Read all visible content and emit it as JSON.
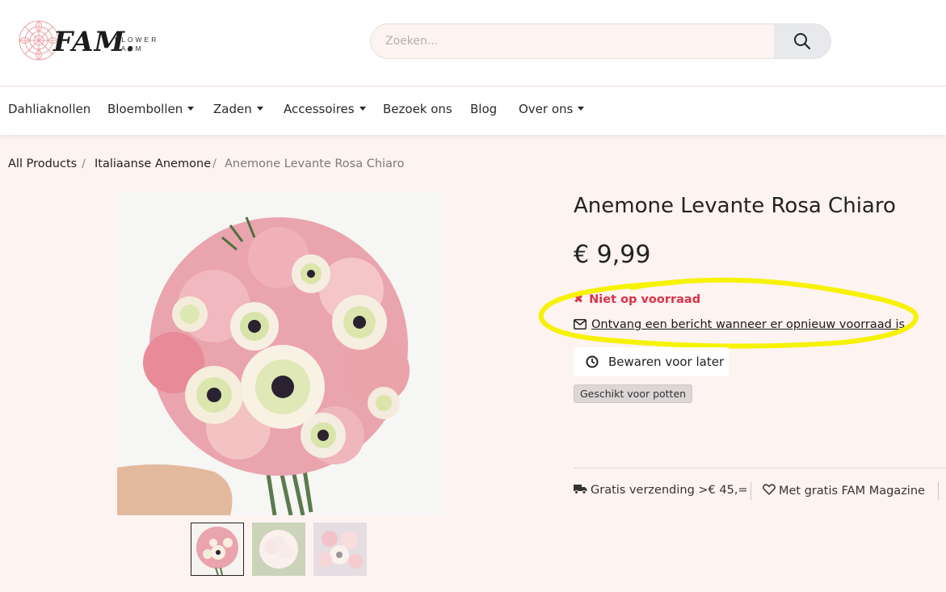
{
  "brand": {
    "logo_main": "FAM.",
    "logo_sub": "FLOWER FARM",
    "primary_color": "#d9334a",
    "highlight_color": "#f7f200",
    "background_color": "#fdf3f1"
  },
  "search": {
    "placeholder": "Zoeken...",
    "icon": "search-icon"
  },
  "nav": {
    "items": [
      {
        "label": "Dahliaknollen",
        "dropdown": false
      },
      {
        "label": "Bloembollen",
        "dropdown": true
      },
      {
        "label": "Zaden",
        "dropdown": true
      },
      {
        "label": "Accessoires",
        "dropdown": true
      },
      {
        "label": "Bezoek ons",
        "dropdown": false
      },
      {
        "label": "Blog",
        "dropdown": false
      },
      {
        "label": "Over ons",
        "dropdown": true
      }
    ]
  },
  "breadcrumb": {
    "items": [
      "All Products",
      "Italiaanse Anemone"
    ],
    "separator": "/",
    "current": "Anemone Levante Rosa Chiaro"
  },
  "product": {
    "title": "Anemone Levante Rosa Chiaro",
    "price": "€ 9,99",
    "stock_status": "Niet op voorraad",
    "stock_icon": "x-icon",
    "notify_text": "Ontvang een bericht wanneer er opnieuw voorraad is",
    "notify_icon": "envelope-icon",
    "save_label": "Bewaren voor later",
    "save_icon": "clock-icon",
    "tag": "Geschikt voor potten",
    "thumbnail_count": 3,
    "active_thumbnail": 1
  },
  "features": {
    "shipping": "Gratis verzending >€ 45,=",
    "shipping_icon": "truck-icon",
    "magazine": "Met gratis FAM Magazine",
    "magazine_icon": "heart-icon"
  }
}
